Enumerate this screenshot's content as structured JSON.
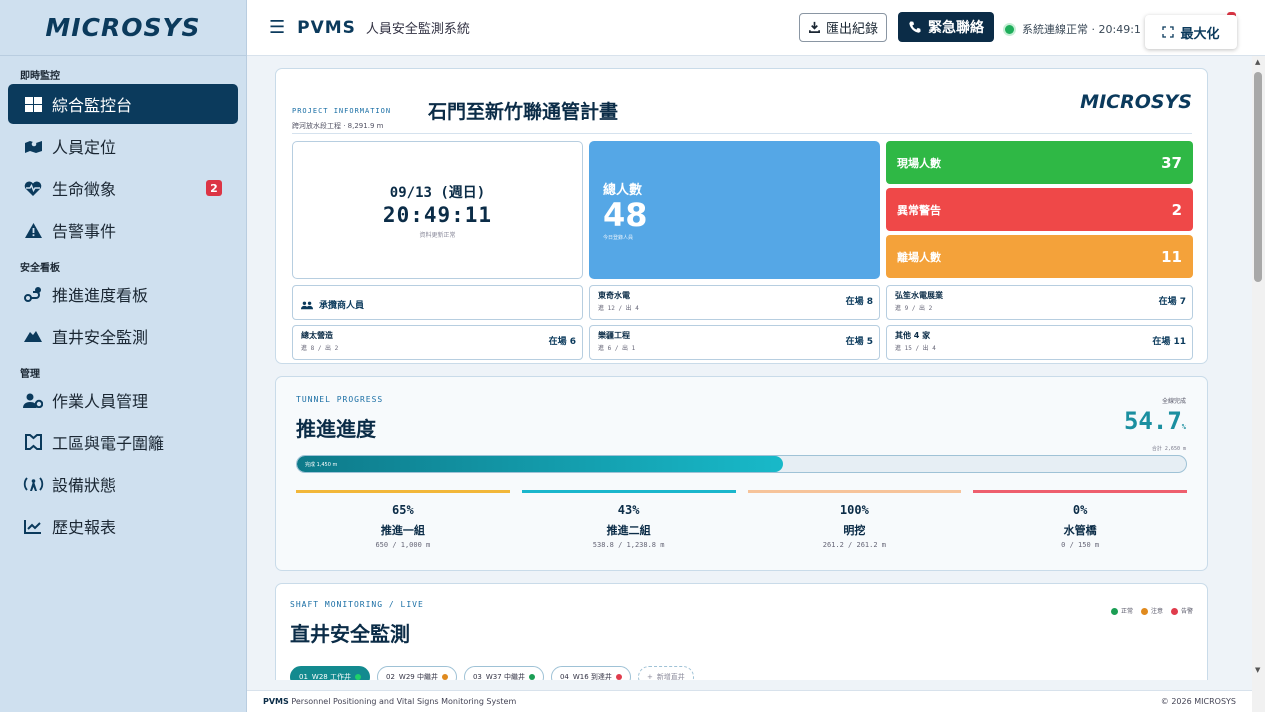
{
  "sidebar": {
    "brand": "MICROSYS",
    "sections": [
      {
        "title": "即時監控",
        "items": [
          {
            "label": "綜合監控台",
            "icon": "dashboard-icon",
            "active": true
          },
          {
            "label": "人員定位",
            "icon": "map-person-icon"
          },
          {
            "label": "生命徵象",
            "icon": "heartbeat-icon",
            "badge": "2"
          },
          {
            "label": "告警事件",
            "icon": "warning-icon"
          }
        ]
      },
      {
        "title": "安全看板",
        "items": [
          {
            "label": "推進進度看板",
            "icon": "route-icon"
          },
          {
            "label": "直井安全監測",
            "icon": "shaft-icon"
          }
        ]
      },
      {
        "title": "管理",
        "items": [
          {
            "label": "作業人員管理",
            "icon": "users-gear-icon"
          },
          {
            "label": "工區與電子圍籬",
            "icon": "fence-icon"
          },
          {
            "label": "設備狀態",
            "icon": "broadcast-icon"
          },
          {
            "label": "歷史報表",
            "icon": "chart-line-icon"
          }
        ]
      }
    ]
  },
  "header": {
    "app_name": "PVMS",
    "app_subtitle": "人員安全監測系統",
    "export_label": "匯出紀錄",
    "emergency_label": "緊急聯絡",
    "status_text": "系統連線正常 · 20:49:1",
    "maximize_label": "最大化"
  },
  "project": {
    "label": "PROJECT INFORMATION",
    "title": "石門至新竹聯通管計畫",
    "subtitle": "跨河放水段工程 · 8,291.9 m",
    "logo": "MICROSYS",
    "date": "09/13 (週日)",
    "time": "20:49:11",
    "update_status": "資料更新正常",
    "total_label": "總人數",
    "total_value": "48",
    "total_sub": "今日登錄人員",
    "onsite_label": "現場人數",
    "onsite_value": "37",
    "alert_label": "異常警告",
    "alert_value": "2",
    "left_label": "離場人數",
    "left_value": "11",
    "contractor_header": "承攬商人員",
    "contractors": [
      {
        "name": "東奇水電",
        "io": "進 12 / 出 4",
        "onsite": "在場 8"
      },
      {
        "name": "弘笙水電展業",
        "io": "進 9 / 出 2",
        "onsite": "在場 7"
      },
      {
        "name": "總太營造",
        "io": "進 8 / 出 2",
        "onsite": "在場 6"
      },
      {
        "name": "樂疆工程",
        "io": "進 6 / 出 1",
        "onsite": "在場 5"
      },
      {
        "name": "其他 4 家",
        "io": "進 15 / 出 4",
        "onsite": "在場 11"
      }
    ]
  },
  "tunnel": {
    "label": "TUNNEL PROGRESS",
    "title": "推進進度",
    "overall_label": "全線完成",
    "overall_value": "54.7",
    "overall_unit": "%",
    "total_length": "合計 2,650 m",
    "bar_text": "完成 1,450 m",
    "progress_fraction": 0.547,
    "segments": [
      {
        "pct": "65%",
        "name": "推進一組",
        "dist": "650 / 1,000 m",
        "color": "#f2b73a"
      },
      {
        "pct": "43%",
        "name": "推進二組",
        "dist": "538.8 / 1,238.8 m",
        "color": "#1ab6cc"
      },
      {
        "pct": "100%",
        "name": "明挖",
        "dist": "261.2 / 261.2 m",
        "color": "#f6c39a"
      },
      {
        "pct": "0%",
        "name": "水管橋",
        "dist": "0 / 150 m",
        "color": "#ee5f6e"
      }
    ]
  },
  "shaft": {
    "label": "SHAFT MONITORING / LIVE",
    "title": "直井安全監測",
    "legend": [
      {
        "label": "正常",
        "color": "#1b9e54"
      },
      {
        "label": "注意",
        "color": "#e08a1e"
      },
      {
        "label": "告警",
        "color": "#e03c4c"
      }
    ],
    "tabs": [
      {
        "label": "W28 工作井",
        "prefix": "01",
        "dot": "#1fd06a",
        "active": true
      },
      {
        "label": "W29 中繼井",
        "prefix": "02",
        "dot": "#e08a1e"
      },
      {
        "label": "W37 中繼井",
        "prefix": "03",
        "dot": "#1b9e54"
      },
      {
        "label": "W16 到達井",
        "prefix": "04",
        "dot": "#e03c4c"
      },
      {
        "label": "新增直井",
        "prefix": "+",
        "add": true
      }
    ]
  },
  "footer": {
    "left_bold": "PVMS",
    "left_text": "Personnel Positioning and Vital Signs Monitoring System",
    "right": "© 2026 MICROSYS"
  }
}
